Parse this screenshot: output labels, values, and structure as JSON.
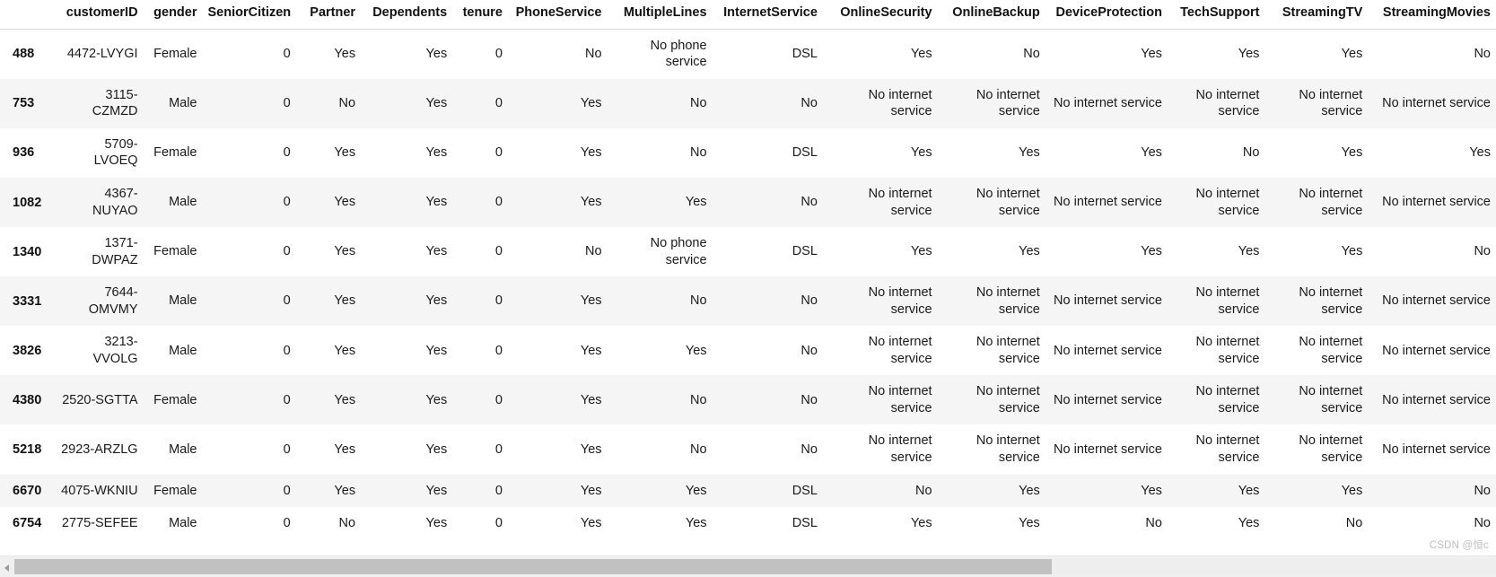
{
  "table": {
    "index_header": "",
    "columns": [
      "customerID",
      "gender",
      "SeniorCitizen",
      "Partner",
      "Dependents",
      "tenure",
      "PhoneService",
      "MultipleLines",
      "InternetService",
      "OnlineSecurity",
      "OnlineBackup",
      "DeviceProtection",
      "TechSupport",
      "StreamingTV",
      "StreamingMovies"
    ],
    "rows": [
      {
        "index": "488",
        "cells": [
          "4472-LVYGI",
          "Female",
          "0",
          "Yes",
          "Yes",
          "0",
          "No",
          "No phone service",
          "DSL",
          "Yes",
          "No",
          "Yes",
          "Yes",
          "Yes",
          "No"
        ]
      },
      {
        "index": "753",
        "cells": [
          "3115-CZMZD",
          "Male",
          "0",
          "No",
          "Yes",
          "0",
          "Yes",
          "No",
          "No",
          "No internet service",
          "No internet service",
          "No internet service",
          "No internet service",
          "No internet service",
          "No internet service"
        ]
      },
      {
        "index": "936",
        "cells": [
          "5709-LVOEQ",
          "Female",
          "0",
          "Yes",
          "Yes",
          "0",
          "Yes",
          "No",
          "DSL",
          "Yes",
          "Yes",
          "Yes",
          "No",
          "Yes",
          "Yes"
        ]
      },
      {
        "index": "1082",
        "cells": [
          "4367-NUYAO",
          "Male",
          "0",
          "Yes",
          "Yes",
          "0",
          "Yes",
          "Yes",
          "No",
          "No internet service",
          "No internet service",
          "No internet service",
          "No internet service",
          "No internet service",
          "No internet service"
        ]
      },
      {
        "index": "1340",
        "cells": [
          "1371-DWPAZ",
          "Female",
          "0",
          "Yes",
          "Yes",
          "0",
          "No",
          "No phone service",
          "DSL",
          "Yes",
          "Yes",
          "Yes",
          "Yes",
          "Yes",
          "No"
        ]
      },
      {
        "index": "3331",
        "cells": [
          "7644-OMVMY",
          "Male",
          "0",
          "Yes",
          "Yes",
          "0",
          "Yes",
          "No",
          "No",
          "No internet service",
          "No internet service",
          "No internet service",
          "No internet service",
          "No internet service",
          "No internet service"
        ]
      },
      {
        "index": "3826",
        "cells": [
          "3213-VVOLG",
          "Male",
          "0",
          "Yes",
          "Yes",
          "0",
          "Yes",
          "Yes",
          "No",
          "No internet service",
          "No internet service",
          "No internet service",
          "No internet service",
          "No internet service",
          "No internet service"
        ]
      },
      {
        "index": "4380",
        "cells": [
          "2520-SGTTA",
          "Female",
          "0",
          "Yes",
          "Yes",
          "0",
          "Yes",
          "No",
          "No",
          "No internet service",
          "No internet service",
          "No internet service",
          "No internet service",
          "No internet service",
          "No internet service"
        ]
      },
      {
        "index": "5218",
        "cells": [
          "2923-ARZLG",
          "Male",
          "0",
          "Yes",
          "Yes",
          "0",
          "Yes",
          "No",
          "No",
          "No internet service",
          "No internet service",
          "No internet service",
          "No internet service",
          "No internet service",
          "No internet service"
        ]
      },
      {
        "index": "6670",
        "cells": [
          "4075-WKNIU",
          "Female",
          "0",
          "Yes",
          "Yes",
          "0",
          "Yes",
          "Yes",
          "DSL",
          "No",
          "Yes",
          "Yes",
          "Yes",
          "Yes",
          "No"
        ]
      },
      {
        "index": "6754",
        "cells": [
          "2775-SEFEE",
          "Male",
          "0",
          "No",
          "Yes",
          "0",
          "Yes",
          "Yes",
          "DSL",
          "Yes",
          "Yes",
          "No",
          "Yes",
          "No",
          "No"
        ]
      }
    ]
  },
  "watermark": {
    "text": "CSDN @恒c"
  },
  "scrollbar": {
    "thumb_percent": 70
  },
  "colors": {
    "header_text": "#111111",
    "cell_text": "#1a1a1a",
    "stripe": "#f5f5f5",
    "rule": "#d9d9d9",
    "watermark": "#bdbdbd",
    "scroll_thumb": "#c1c1c1"
  }
}
